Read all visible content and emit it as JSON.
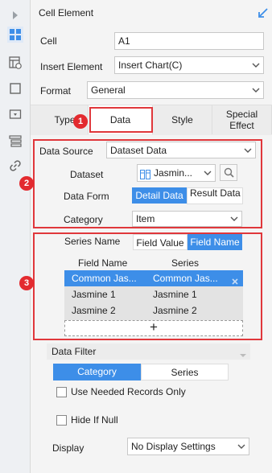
{
  "panel_title": "Cell Element",
  "fields": {
    "cell_label": "Cell",
    "cell_value": "A1",
    "insert_element_label": "Insert Element",
    "insert_element_value": "Insert Chart(C)",
    "format_label": "Format",
    "format_value": "General"
  },
  "tabs": [
    {
      "label": "Type"
    },
    {
      "label": "Data"
    },
    {
      "label": "Style"
    },
    {
      "label": "Special Effect"
    }
  ],
  "active_tab": "Data",
  "callouts": [
    "1",
    "2",
    "3"
  ],
  "data_source": {
    "label": "Data Source",
    "value": "Dataset Data",
    "dataset_label": "Dataset",
    "dataset_value": "Jasmin...",
    "data_form_label": "Data Form",
    "data_form_options": [
      "Detail Data",
      "Result Data"
    ],
    "data_form_selected": "Detail Data",
    "category_label": "Category",
    "category_value": "Item"
  },
  "series": {
    "series_name_label": "Series Name",
    "options": [
      "Field Value",
      "Field Name"
    ],
    "selected": "Field Name",
    "columns": [
      "Field Name",
      "Series"
    ],
    "rows": [
      {
        "field_name": "Common Jas...",
        "series": "Common Jas...",
        "selected": true
      },
      {
        "field_name": "Jasmine 1",
        "series": "Jasmine 1",
        "selected": false
      },
      {
        "field_name": "Jasmine 2",
        "series": "Jasmine 2",
        "selected": false
      }
    ],
    "add_symbol": "+"
  },
  "data_filter": {
    "label": "Data Filter",
    "tabs": [
      "Category",
      "Series"
    ],
    "selected_tab": "Category",
    "use_needed_records_label": "Use Needed Records Only",
    "hide_if_null_label": "Hide If Null"
  },
  "display": {
    "label": "Display",
    "value": "No Display Settings"
  },
  "colors": {
    "accent": "#3d8ee8",
    "callout_red": "#e0373b"
  },
  "icons": [
    "expand-arrow-icon",
    "cell-element-icon",
    "cell-attribute-icon",
    "widget-icon",
    "dropdown-widget-icon",
    "condition-attribute-icon",
    "hyperlink-icon",
    "collapse-panel-icon",
    "search-icon",
    "dataset-icon",
    "remove-icon"
  ]
}
